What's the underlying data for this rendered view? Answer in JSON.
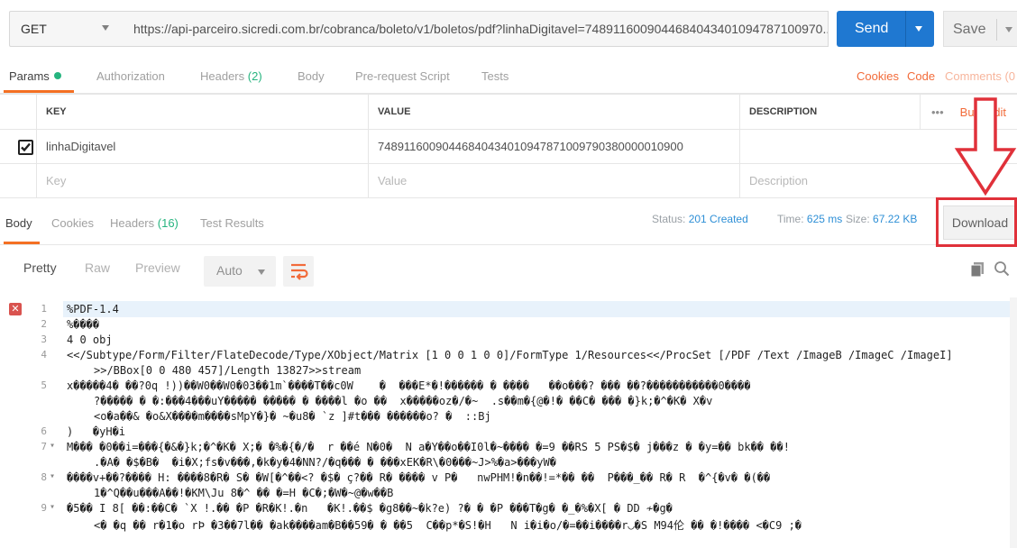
{
  "request": {
    "method": "GET",
    "url": "https://api-parceiro.sicredi.com.br/cobranca/boleto/v1/boletos/pdf?linhaDigitavel=7489116009044684043401094787100970...",
    "send_label": "Send",
    "save_label": "Save"
  },
  "request_tabs": {
    "params": "Params",
    "authorization": "Authorization",
    "headers": "Headers",
    "headers_count": "(2)",
    "body": "Body",
    "prerequest": "Pre-request Script",
    "tests": "Tests",
    "cookies": "Cookies",
    "code": "Code",
    "comments": "Comments (0"
  },
  "params_table": {
    "headers": [
      "KEY",
      "VALUE",
      "DESCRIPTION"
    ],
    "more": "•••",
    "bulk_edit": "Bulk Edit",
    "rows": [
      {
        "key": "linhaDigitavel",
        "value": "74891160090446840434010947871009790380000010900",
        "description": ""
      }
    ],
    "placeholder": {
      "key": "Key",
      "value": "Value",
      "description": "Description"
    }
  },
  "response": {
    "tabs": {
      "body": "Body",
      "cookies": "Cookies",
      "headers": "Headers",
      "headers_count": "(16)",
      "test_results": "Test Results"
    },
    "status_label": "Status:",
    "status_value": "201 Created",
    "time_label": "Time:",
    "time_value": "625 ms",
    "size_label": "Size:",
    "size_value": "67.22 KB",
    "download_label": "Download"
  },
  "view": {
    "pretty": "Pretty",
    "raw": "Raw",
    "preview": "Preview",
    "format": "Auto"
  },
  "code_lines": [
    {
      "n": "1",
      "text": "%PDF-1.4"
    },
    {
      "n": "2",
      "text": "%����"
    },
    {
      "n": "3",
      "text": "4 0 obj"
    },
    {
      "n": "4",
      "text": "<</Subtype/Form/Filter/FlateDecode/Type/XObject/Matrix [1 0 0 1 0 0]/FormType 1/Resources<</ProcSet [/PDF /Text /ImageB /ImageC /ImageI]"
    },
    {
      "n": "",
      "text": ">>/BBox[0 0 480 457]/Length 13827>>stream"
    },
    {
      "n": "5",
      "text": "x�����4� ��?0q !))��W0��W0�03��1m`����T��c0W    �  ���E*�!������ � ����   ��o���? ��� ��?�����������0����"
    },
    {
      "n": "",
      "text": "?����� � �:���4���uY����� ����� � ����l �o ��  x�����oz�/�~  .s��m�{@�!� ��C� ��� �}k;�^�K� X�v"
    },
    {
      "n": "",
      "text": "<o�a��& �o&X����m����sMpY�}� ~�u8� `z ]#t��� ������o? �  ::Bj"
    },
    {
      "n": "6",
      "text": ")   �yH�i"
    },
    {
      "n": "7",
      "text": "M��� �0��i=���{�&�}k;�^�K� X;� �%�{�/�  r ��é N�0�  N a�Y��o��I0l�~���� �=9 ��RS 5 PS�$� j���z � �y=�� bk�� ��!"
    },
    {
      "n": "",
      "text": ".�A� �$�B�  �i�X;fs�v���,�k�y�4�NN?/�q��� � ���xEK�R\\�0���~J>%�a>���yW�"
    },
    {
      "n": "8",
      "text": "����v+��?���� H: ����8�R� S� �W[�^��<? �$� ç?�� R� ���� v P�   nwPHM!�n��!=*�� ��  P���_�� R� R  �^{�v� �(��"
    },
    {
      "n": "",
      "text": "1�^Q��u���A��!�KM\\Ju 8�^ �� �=H �C�;�W�~@�w��B"
    },
    {
      "n": "9",
      "text": "�5�� I 8[ ��:��C� `X !.�� �P �R�K!.�n   �K!.��$ �g8��~�k?e) ?� � �P ���T�g� �_�%�X[ � DD ≁�g�"
    },
    {
      "n": "",
      "text": "<� �q �� r�1�o rÞ �3��7l�� �ak����am�B��59� � ��5  C��p*�S!�H   N i�i�o/�=��i����r◡�S M94伦 �� �!���� <�C9 ;�"
    }
  ]
}
